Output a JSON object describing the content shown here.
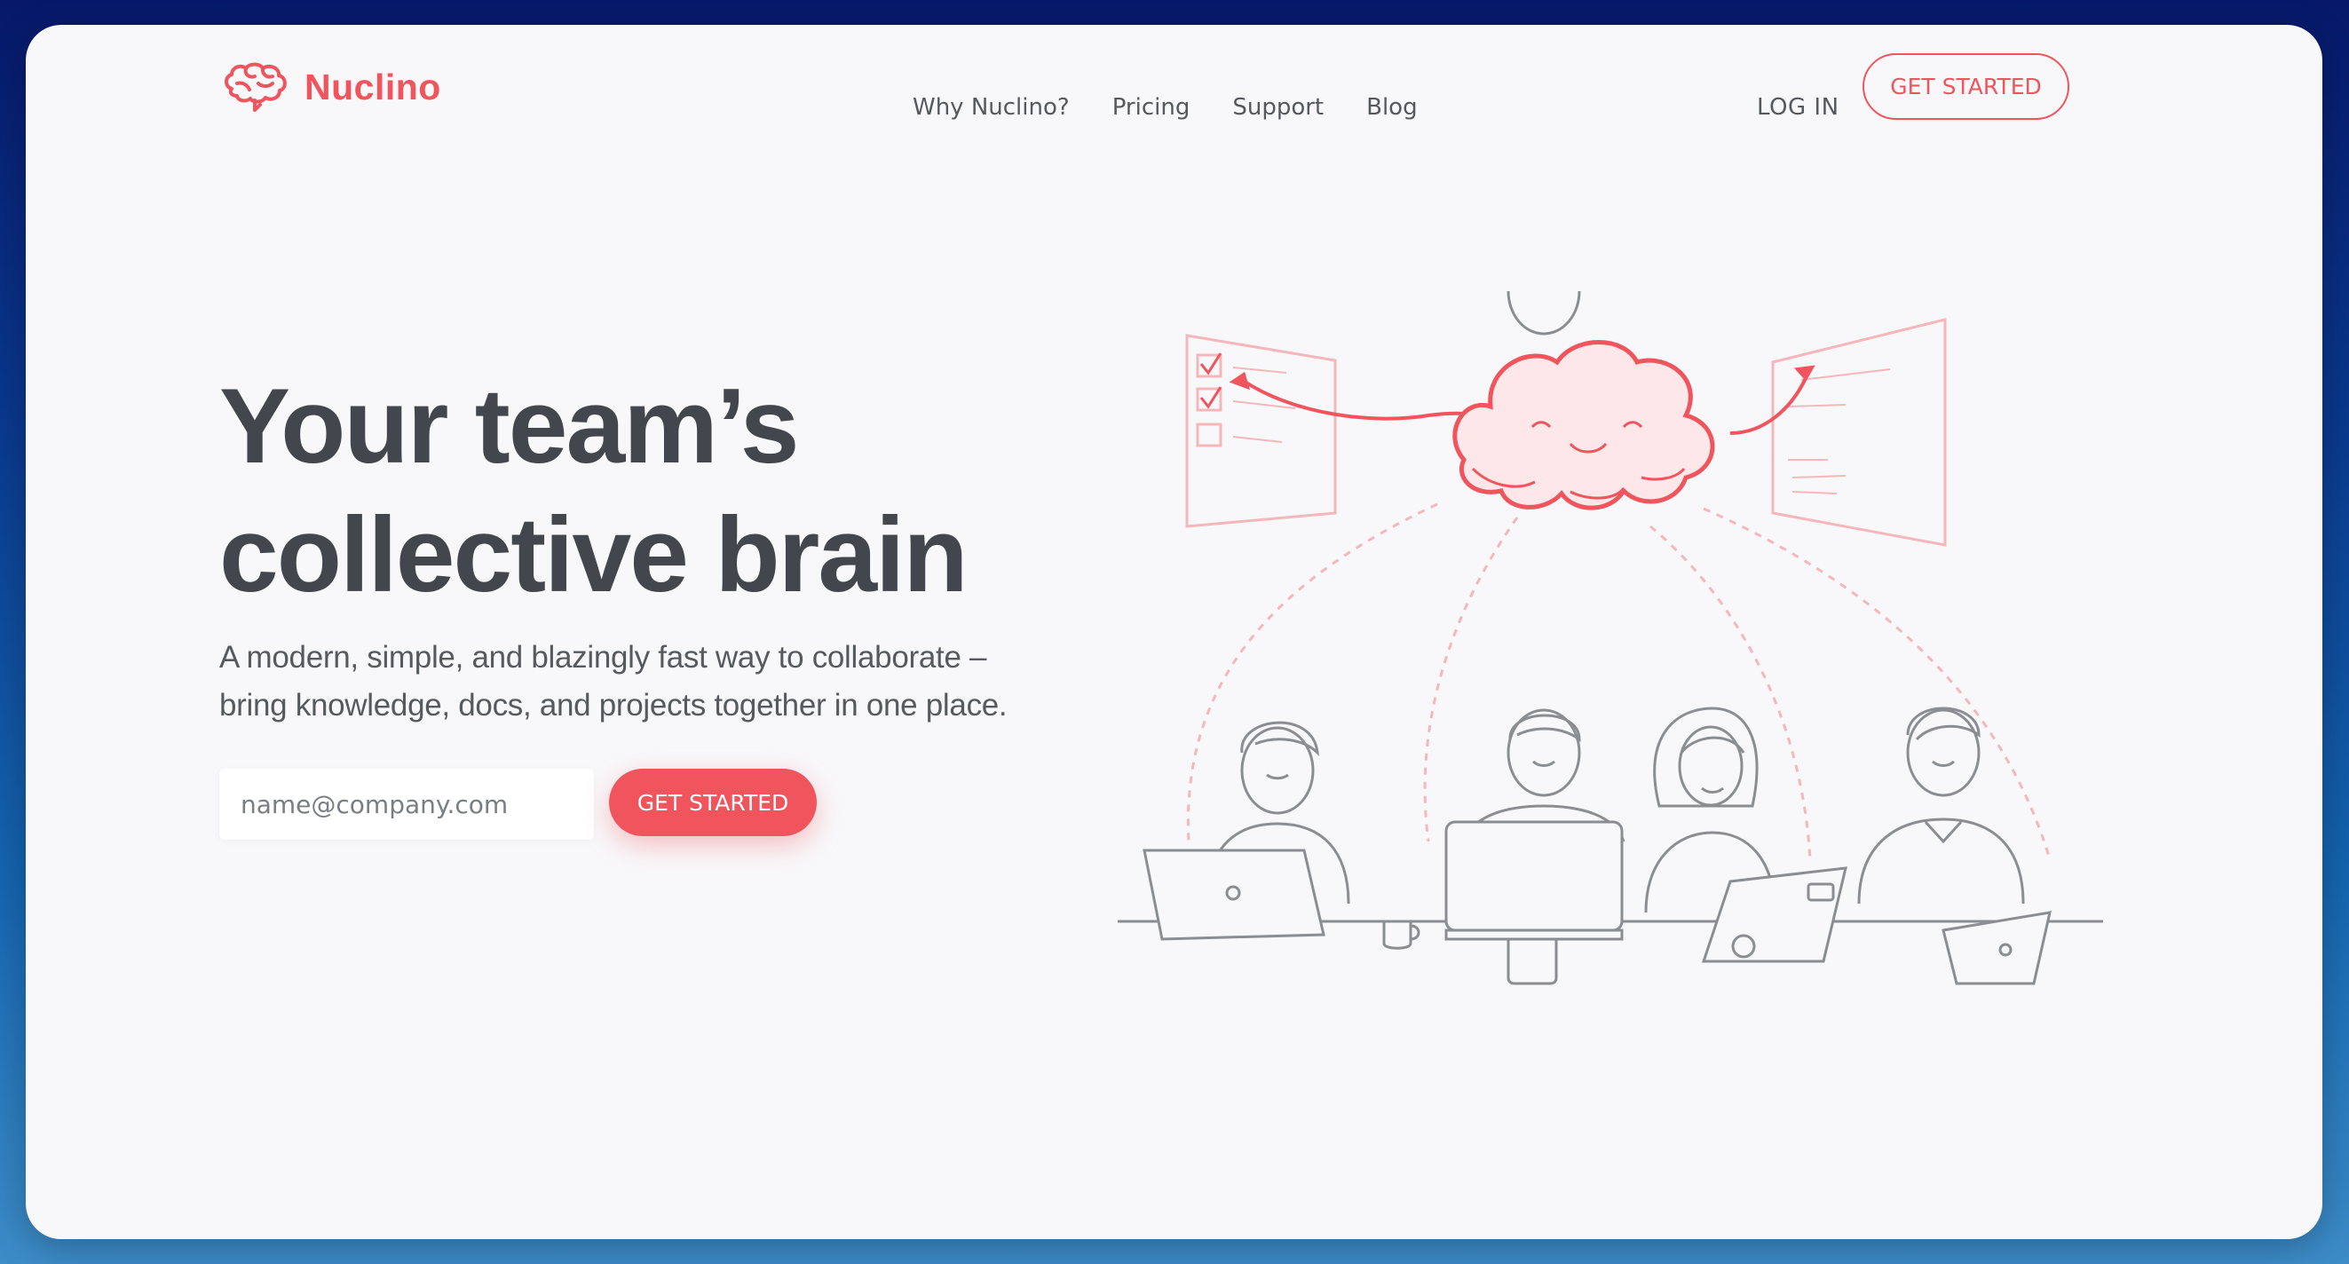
{
  "brand": {
    "name": "Nuclino",
    "accent_color": "#f0545d",
    "logo_icon": "brain-icon"
  },
  "nav": {
    "items": [
      {
        "label": "Why Nuclino?"
      },
      {
        "label": "Pricing"
      },
      {
        "label": "Support"
      },
      {
        "label": "Blog"
      }
    ],
    "login_label": "LOG IN",
    "cta_label": "GET STARTED"
  },
  "hero": {
    "title_line1": "Your team’s",
    "title_line2": "collective brain",
    "subtitle_line1": "A modern, simple, and blazingly fast way to collaborate –",
    "subtitle_line2": "bring knowledge, docs, and projects together in one place.",
    "email_placeholder": "name@company.com",
    "email_value": "",
    "cta_label": "GET STARTED"
  },
  "illustration": {
    "icon": "team-cloud-illustration",
    "line_color": "#8a8d91",
    "accent_color": "#f0545d"
  }
}
